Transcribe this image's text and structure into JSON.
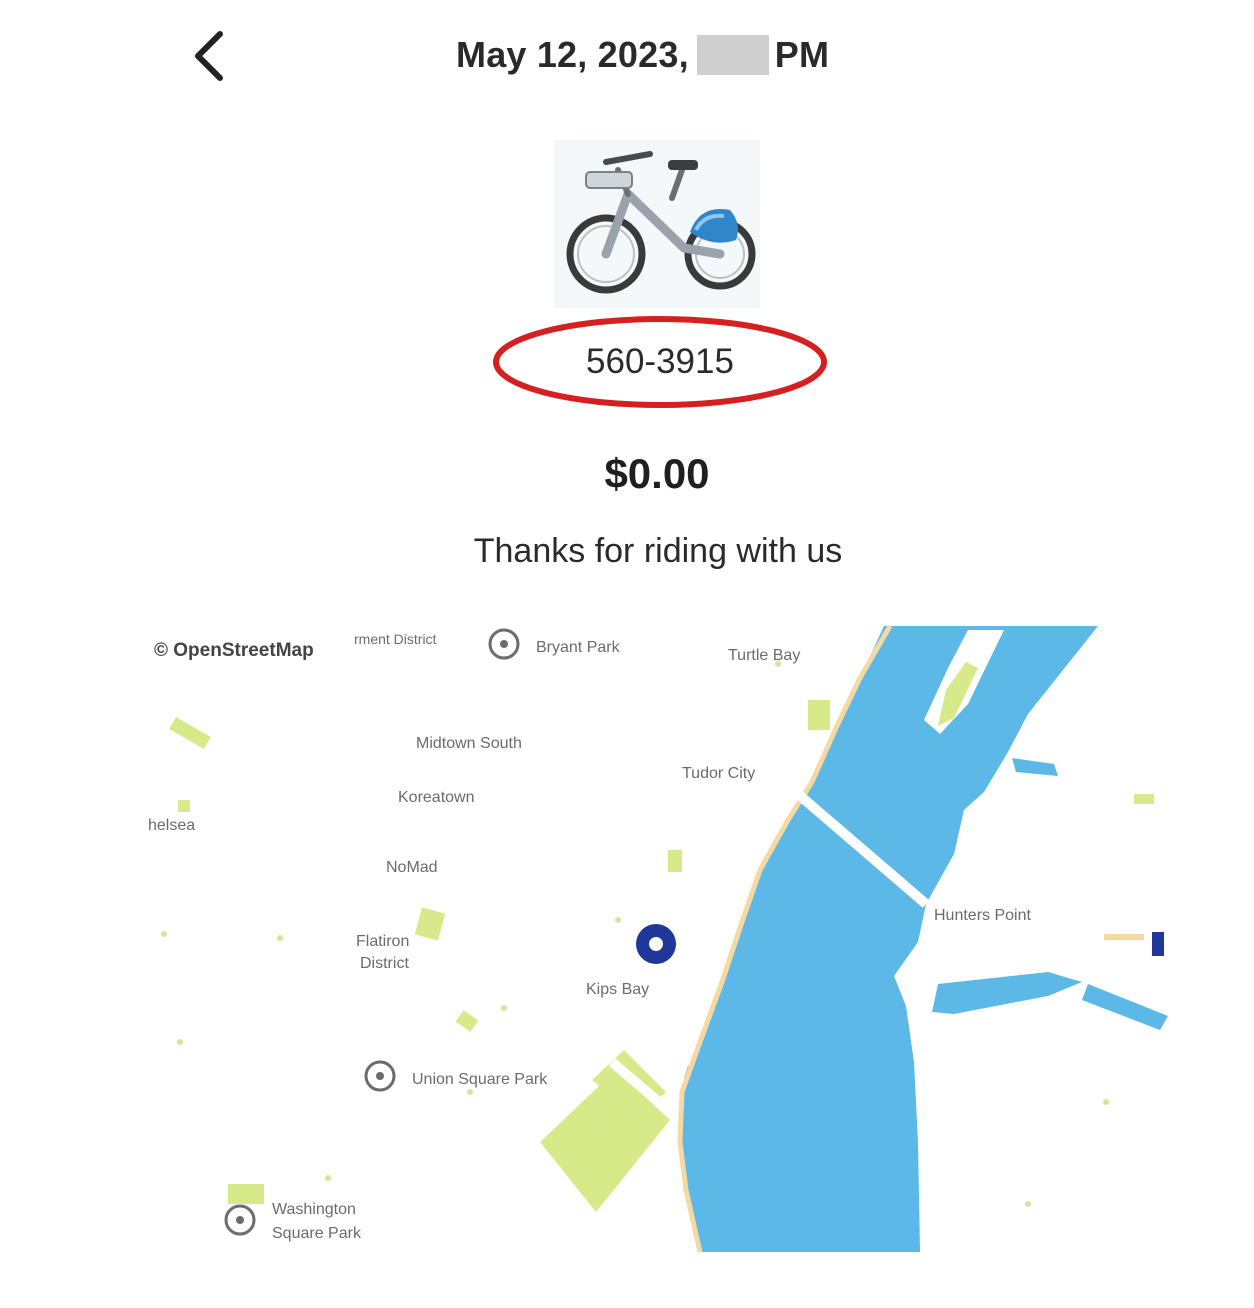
{
  "header": {
    "date_text": "May 12, 2023,",
    "time_suffix": "PM"
  },
  "ride": {
    "bike_id": "560-3915",
    "price": "$0.00",
    "message": "Thanks for riding with us"
  },
  "map": {
    "attribution": "© OpenStreetMap",
    "labels": {
      "garment_district": "rment District",
      "bryant_park": "Bryant Park",
      "turtle_bay": "Turtle Bay",
      "midtown_south": "Midtown South",
      "tudor_city": "Tudor City",
      "koreatown": "Koreatown",
      "chelsea": "helsea",
      "nomad": "NoMad",
      "flatiron_line1": "Flatiron",
      "flatiron_line2": "District",
      "kips_bay": "Kips Bay",
      "hunters_point": "Hunters Point",
      "union_square_park": "Union Square Park",
      "washington_line1": "Washington",
      "washington_line2": "Square Park"
    }
  },
  "colors": {
    "water": "#5cb8e6",
    "park": "#d6ea8a",
    "highlight_ring": "#d42020",
    "location_marker": "#1e3799"
  }
}
